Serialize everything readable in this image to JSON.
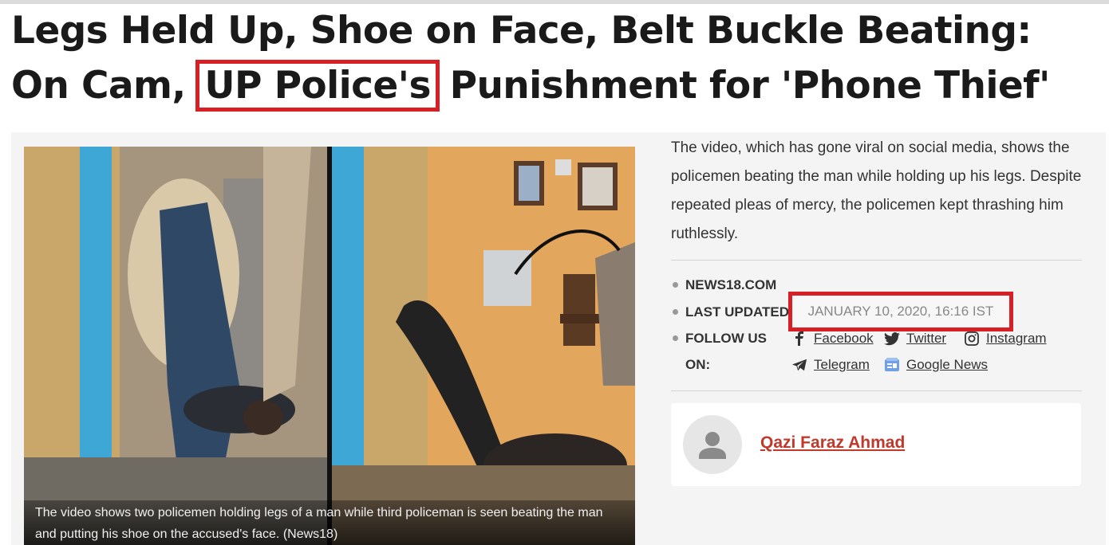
{
  "article": {
    "headline_part1": "Legs Held Up, Shoe on Face, Belt Buckle Beating: On Cam,",
    "headline_highlight": "UP Police's",
    "headline_part2": "Punishment for 'Phone Thief'",
    "summary": "The video, which has gone viral on social media, shows the policemen beating the man while holding up his legs. Despite repeated pleas of mercy, the policemen kept thrashing him ruthlessly.",
    "image_caption": "The video shows two policemen holding legs of a man while third policeman is seen beating the man and putting his shoe on the accused's face. (News18)"
  },
  "meta": {
    "source": "NEWS18.COM",
    "last_updated_label": "LAST UPDATED",
    "last_updated_value": "JANUARY 10, 2020, 16:16 IST",
    "follow_label_1": "FOLLOW US",
    "follow_label_2": "ON:"
  },
  "social": {
    "facebook": "Facebook",
    "twitter": "Twitter",
    "instagram": "Instagram",
    "telegram": "Telegram",
    "google_news": "Google News"
  },
  "author": {
    "name": "Qazi Faraz Ahmad"
  },
  "colors": {
    "highlight_red": "#d91f26",
    "author_link": "#c0392b"
  }
}
